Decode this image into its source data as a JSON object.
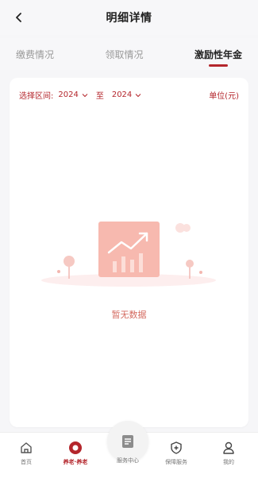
{
  "header": {
    "title": "明细详情"
  },
  "tabs": [
    {
      "label": "缴费情况",
      "active": false
    },
    {
      "label": "领取情况",
      "active": false
    },
    {
      "label": "激励性年金",
      "active": true
    }
  ],
  "filter": {
    "label": "选择区间:",
    "start_year": "2024",
    "to_label": "至",
    "end_year": "2024",
    "unit_label": "单位(元)"
  },
  "empty_state": {
    "message": "暂无数据"
  },
  "bottom_nav": {
    "items": [
      {
        "label": "首页",
        "icon": "home-icon",
        "active": false
      },
      {
        "label": "养老·养老",
        "icon": "pension-icon",
        "active": true
      },
      {
        "label": "服务中心",
        "icon": "service-center-icon",
        "active": false
      },
      {
        "label": "保障服务",
        "icon": "shield-icon",
        "active": false
      },
      {
        "label": "我的",
        "icon": "user-icon",
        "active": false
      }
    ]
  },
  "colors": {
    "accent": "#b4262c",
    "empty_text": "#d46a5f",
    "background": "#f6f6f8"
  }
}
